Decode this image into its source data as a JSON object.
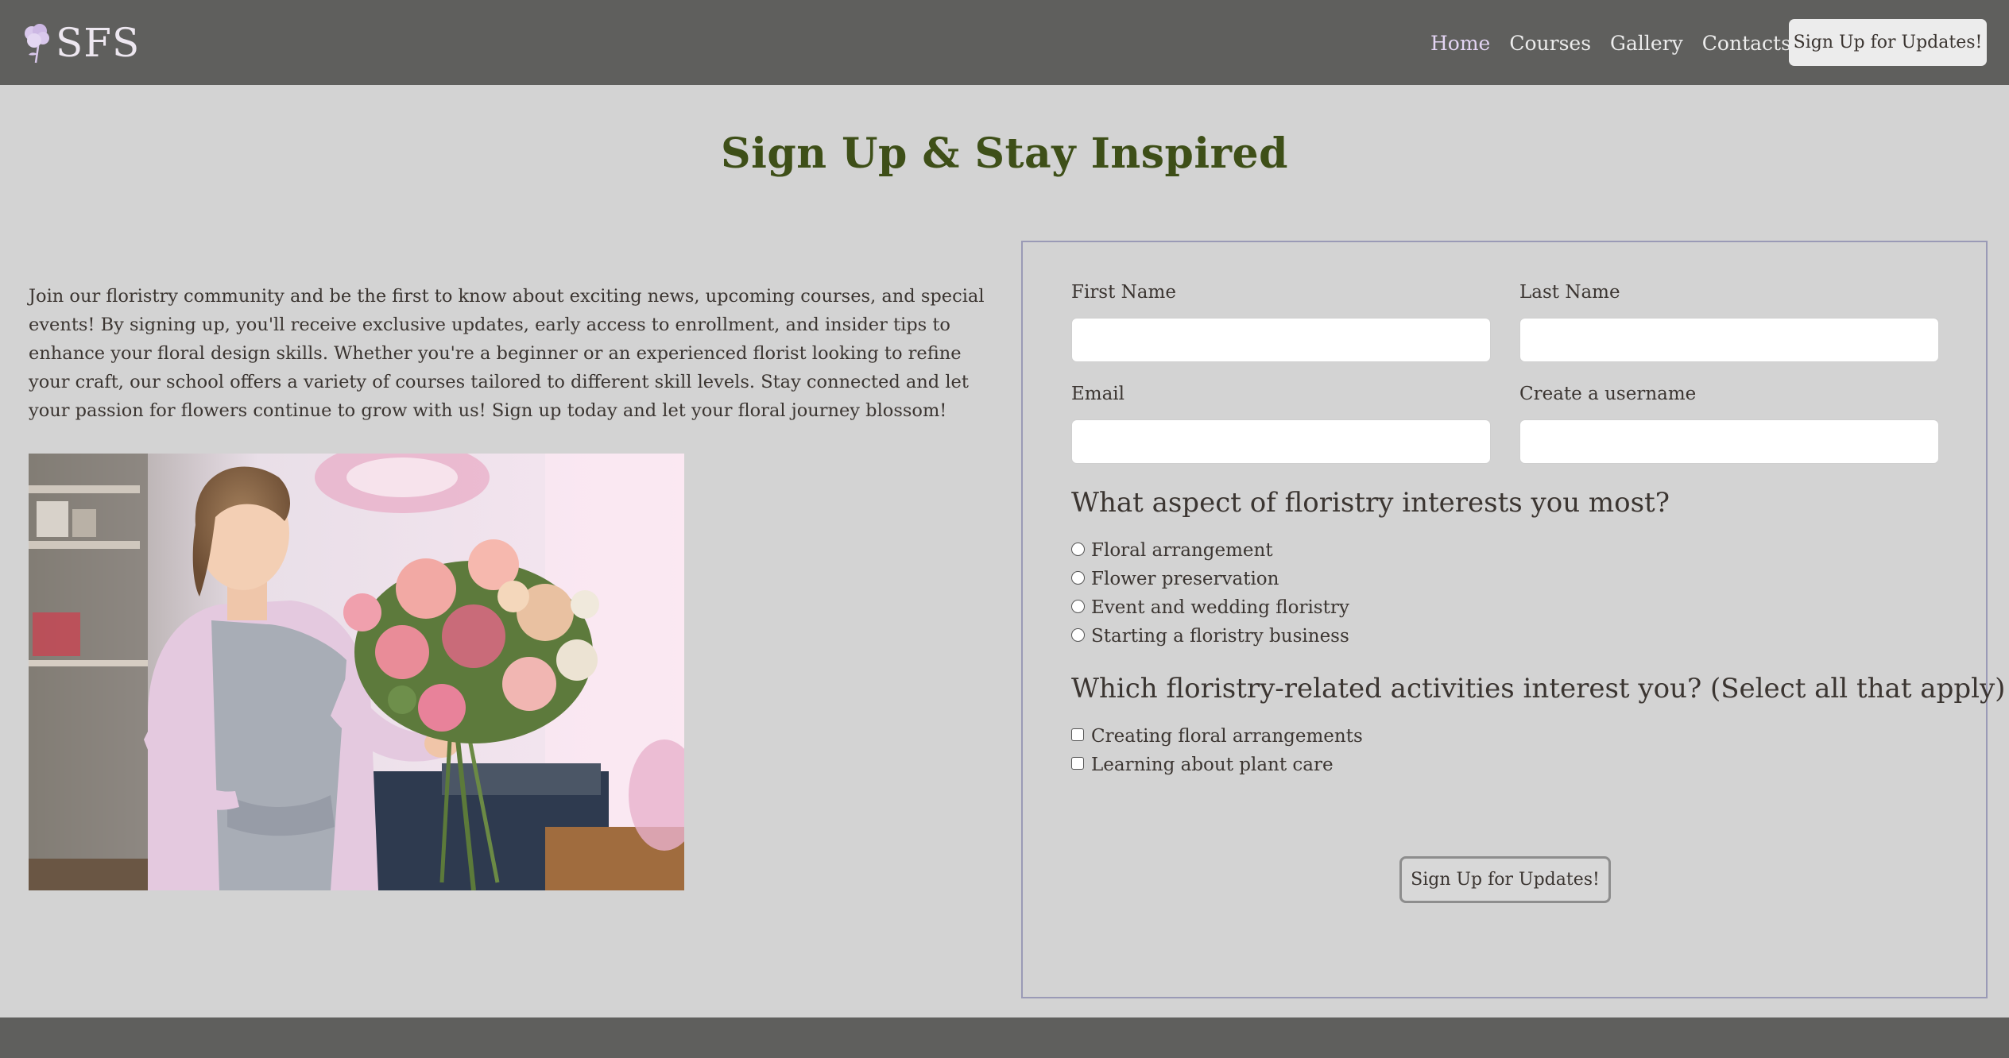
{
  "brand": {
    "logo_text": "SFS",
    "icon": "flower-icon"
  },
  "nav": {
    "links": [
      {
        "label": "Home",
        "active": true
      },
      {
        "label": "Courses",
        "active": false
      },
      {
        "label": "Gallery",
        "active": false
      },
      {
        "label": "Contacts",
        "active": false
      }
    ],
    "cta_label": "Sign Up for Updates!"
  },
  "main": {
    "title": "Sign Up & Stay Inspired",
    "intro": "Join our floristry community and be the first to know about exciting news, upcoming courses, and special events! By signing up, you'll receive exclusive updates, early access to enrollment, and insider tips to enhance your floral design skills. Whether you're a beginner or an experienced florist looking to refine your craft, our school offers a variety of courses tailored to different skill levels. Stay connected and let your passion for flowers continue to grow with us! Sign up today and let your floral journey blossom!"
  },
  "form": {
    "first_name_label": "First Name",
    "first_name_value": "",
    "last_name_label": "Last Name",
    "last_name_value": "",
    "email_label": "Email",
    "email_value": "",
    "username_label": "Create a username",
    "username_value": "",
    "q1": "What aspect of floristry interests you most?",
    "q1_options": [
      "Floral arrangement",
      "Flower preservation",
      "Event and wedding floristry",
      "Starting a floristry business"
    ],
    "q2": "Which floristry-related activities interest you? (Select all that apply)",
    "q2_options": [
      "Creating floral arrangements",
      "Learning about plant care"
    ],
    "submit_label": "Sign Up for Updates!"
  },
  "colors": {
    "nav_bg": "#5f5f5d",
    "page_bg": "#d3d3d3",
    "title": "#3e4f18",
    "nav_active": "#e3d4f3",
    "form_border": "#9a9ab6"
  }
}
